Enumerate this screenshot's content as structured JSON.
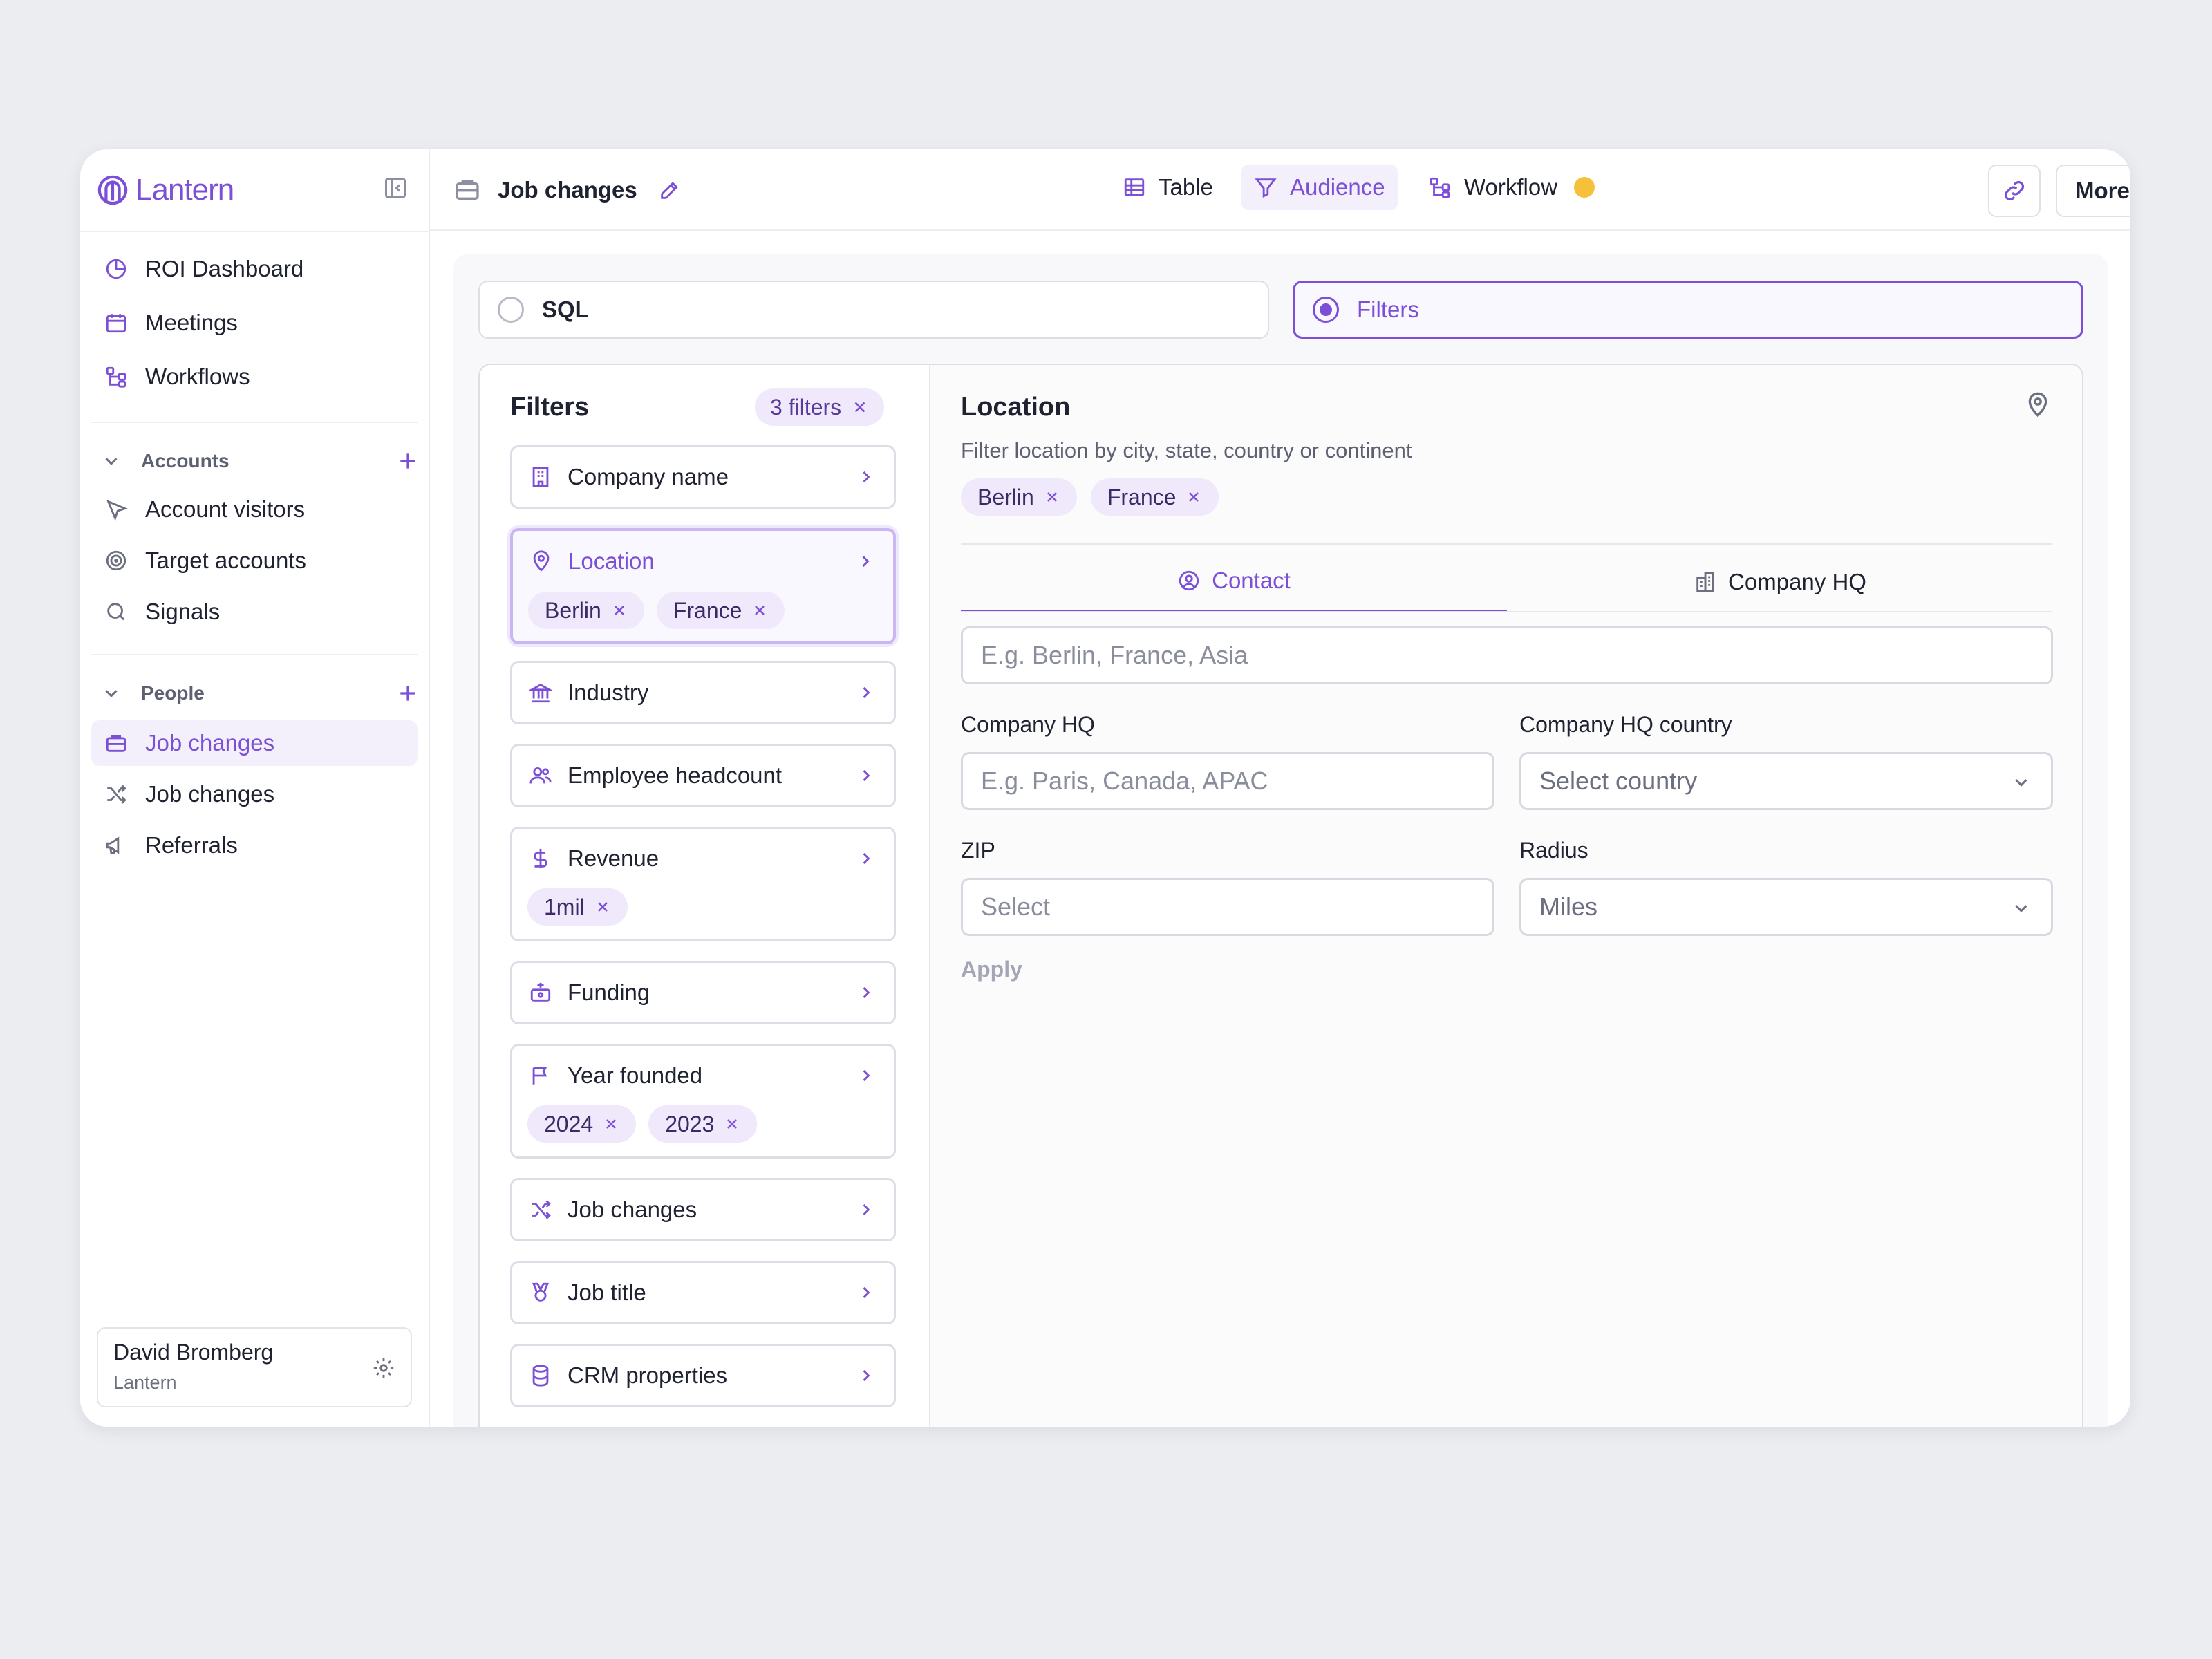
{
  "brand": {
    "name": "Lantern"
  },
  "sidebar": {
    "top_items": [
      {
        "label": "ROI Dashboard",
        "icon": "pie-chart-icon"
      },
      {
        "label": "Meetings",
        "icon": "calendar-icon"
      },
      {
        "label": "Workflows",
        "icon": "workflow-icon"
      }
    ],
    "accounts": {
      "label": "Accounts",
      "items": [
        {
          "label": "Account visitors",
          "icon": "cursor-icon"
        },
        {
          "label": "Target accounts",
          "icon": "target-icon"
        },
        {
          "label": "Signals",
          "icon": "search-icon"
        }
      ]
    },
    "people": {
      "label": "People",
      "items": [
        {
          "label": "Job changes",
          "icon": "briefcase-icon",
          "active": true
        },
        {
          "label": "Job changes",
          "icon": "shuffle-icon"
        },
        {
          "label": "Referrals",
          "icon": "megaphone-icon"
        }
      ]
    },
    "user": {
      "name": "David Bromberg",
      "org": "Lantern"
    }
  },
  "topbar": {
    "title": "Job changes",
    "views": [
      {
        "label": "Table",
        "icon": "table-icon"
      },
      {
        "label": "Audience",
        "icon": "filter-icon",
        "active": true
      },
      {
        "label": "Workflow",
        "icon": "workflow-icon"
      }
    ],
    "more_label": "More",
    "status_color": "#f5c03a"
  },
  "mode": {
    "sql_label": "SQL",
    "filters_label": "Filters",
    "selected": "Filters"
  },
  "filters": {
    "title": "Filters",
    "count_label": "3 filters",
    "items": [
      {
        "label": "Company name",
        "icon": "building-icon",
        "chips": []
      },
      {
        "label": "Location",
        "icon": "map-pin-icon",
        "chips": [
          "Berlin",
          "France"
        ],
        "active": true
      },
      {
        "label": "Industry",
        "icon": "bank-icon",
        "chips": []
      },
      {
        "label": "Employee headcount",
        "icon": "users-icon",
        "chips": []
      },
      {
        "label": "Revenue",
        "icon": "dollar-icon",
        "chips": [
          "1mil"
        ]
      },
      {
        "label": "Funding",
        "icon": "funding-icon",
        "chips": []
      },
      {
        "label": "Year founded",
        "icon": "flag-icon",
        "chips": [
          "2024",
          "2023"
        ]
      },
      {
        "label": "Job changes",
        "icon": "shuffle-icon",
        "chips": []
      },
      {
        "label": "Job title",
        "icon": "medal-icon",
        "chips": []
      },
      {
        "label": "CRM properties",
        "icon": "database-icon",
        "chips": []
      }
    ]
  },
  "location": {
    "title": "Location",
    "description": "Filter location by city, state, country or continent",
    "chips": [
      "Berlin",
      "France"
    ],
    "tabs": [
      {
        "label": "Contact",
        "icon": "user-circle-icon",
        "active": true
      },
      {
        "label": "Company HQ",
        "icon": "buildings-icon"
      }
    ],
    "search_placeholder": "E.g. Berlin, France, Asia",
    "company_hq_label": "Company HQ",
    "company_hq_placeholder": "E.g. Paris, Canada, APAC",
    "company_hq_country_label": "Company HQ country",
    "company_hq_country_value": "Select country",
    "zip_label": "ZIP",
    "zip_placeholder": "Select",
    "radius_label": "Radius",
    "radius_value": "Miles",
    "apply_label": "Apply"
  },
  "colors": {
    "accent": "#7b4fd6",
    "chip_bg": "#efe9fb",
    "background": "#ecedf1"
  }
}
